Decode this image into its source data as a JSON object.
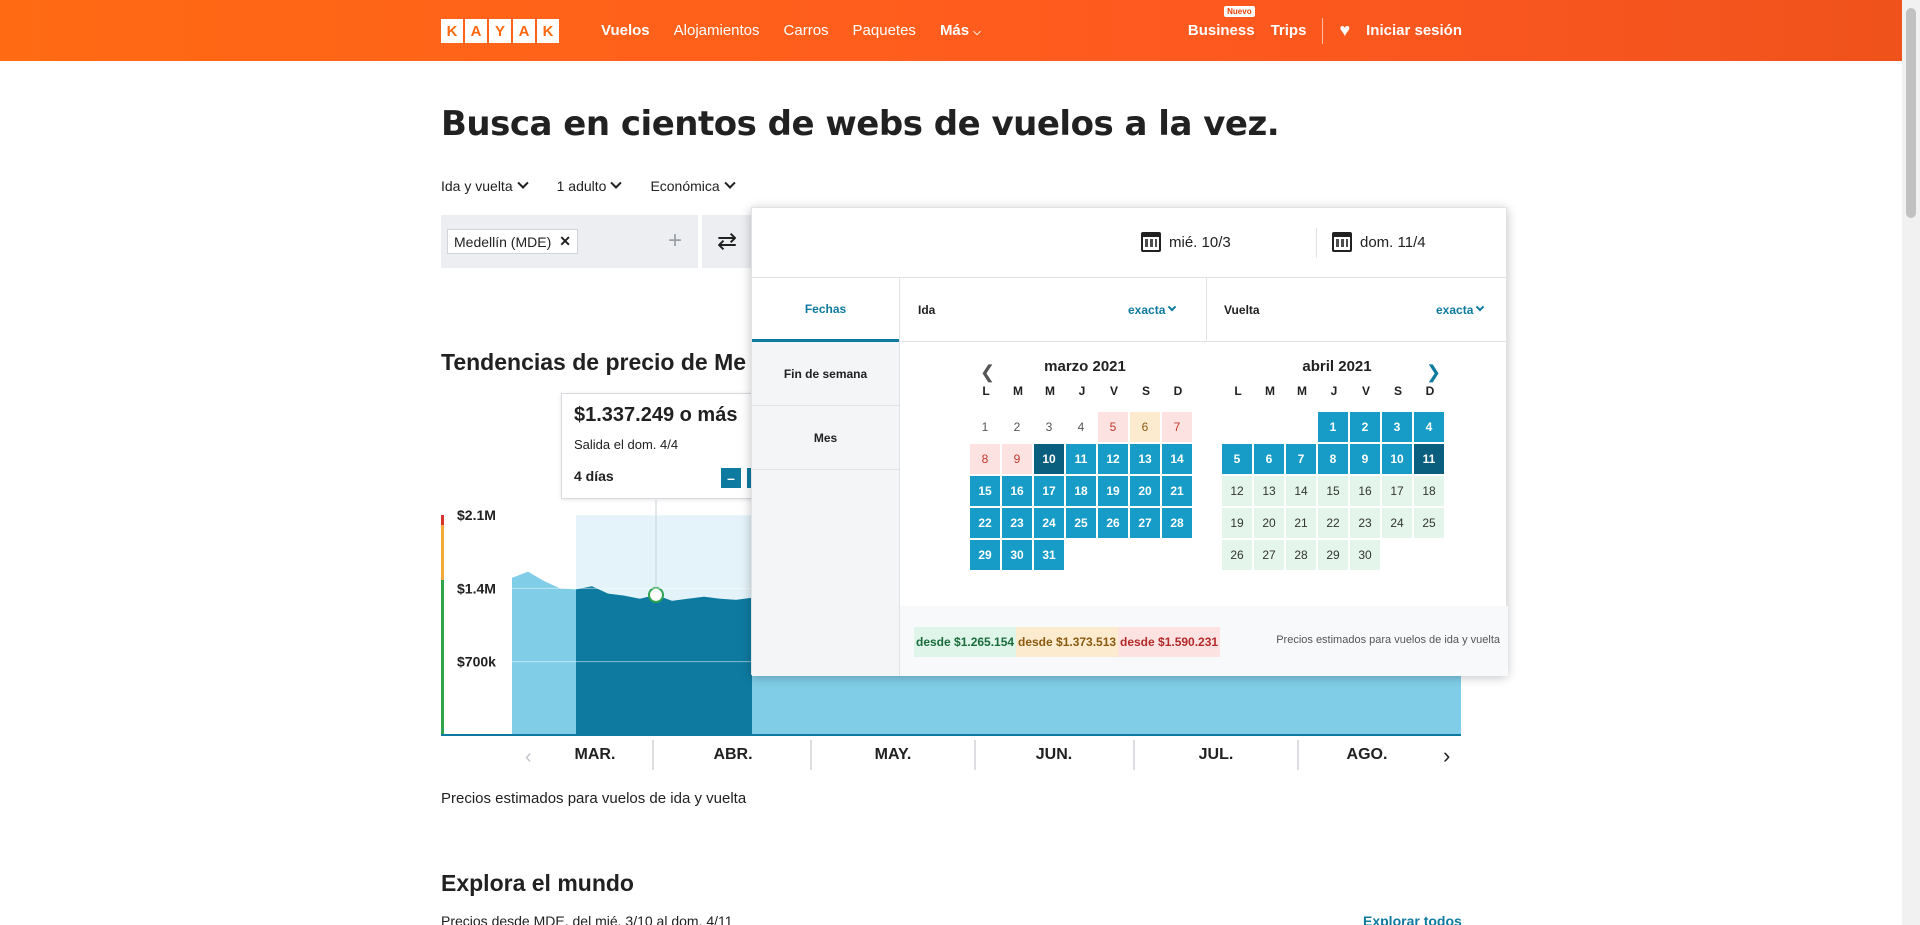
{
  "header": {
    "logo_letters": [
      "K",
      "A",
      "Y",
      "A",
      "K"
    ],
    "nav": [
      "Vuelos",
      "Alojamientos",
      "Carros",
      "Paquetes",
      "Más"
    ],
    "business": "Business",
    "business_badge": "Nuevo",
    "trips": "Trips",
    "login": "Iniciar sesión"
  },
  "main": {
    "title": "Busca en cientos de webs de vuelos a la vez.",
    "options": [
      "Ida y vuelta",
      "1 adulto",
      "Económica"
    ],
    "origin_chip": "Medellín (MDE)",
    "trend_title": "Tendencias de precio de Me",
    "note": "Precios estimados para vuelos de ida y vuelta",
    "explore_title": "Explora el mundo",
    "explore_sub": "Precios desde MDE, del mié. 3/10 al dom. 4/11",
    "explore_link": "Explorar todos"
  },
  "tooltip": {
    "price": "$1.337.249 o más",
    "departure": "Salida el dom. 4/4",
    "duration": "4 días",
    "minus": "–"
  },
  "chart_data": {
    "type": "area",
    "y_ticks": [
      "$2.1M",
      "$1.4M",
      "$700k"
    ],
    "x_months": [
      "MAR.",
      "ABR.",
      "MAY.",
      "JUN.",
      "JUL.",
      "AGO."
    ],
    "ylim": [
      0,
      2100000
    ],
    "values": [
      1500000,
      1560000,
      1470000,
      1400000,
      1390000,
      1420000,
      1350000,
      1330000,
      1300000,
      1337249,
      1280000,
      1300000,
      1320000,
      1300000,
      1290000,
      1310000
    ],
    "selected_range_start": 4,
    "selected_range_end": 15,
    "colors": {
      "area": "#7fcde6",
      "selected": "#0e7aa0",
      "highlight_bg": "#e3f3f9"
    }
  },
  "popup": {
    "depart_date": "mié. 10/3",
    "return_date": "dom. 11/4",
    "tabs": [
      "Fechas",
      "Fin de semana",
      "Mes"
    ],
    "leg_depart": "Ida",
    "leg_return": "Vuelta",
    "exact": "exacta",
    "march_title": "marzo 2021",
    "april_title": "abril 2021",
    "dow": [
      "L",
      "M",
      "M",
      "J",
      "V",
      "S",
      "D"
    ],
    "price_green": "desde $1.265.154",
    "price_orange": "desde $1.373.513",
    "price_red": "desde $1.590.231",
    "foot_note": "Precios estimados para vuelos de ida y vuelta"
  },
  "calendar": {
    "march": {
      "offset": 0,
      "days": [
        [
          "1",
          "plain"
        ],
        [
          "2",
          "plain"
        ],
        [
          "3",
          "plain"
        ],
        [
          "4",
          "plain"
        ],
        [
          "5",
          "red"
        ],
        [
          "6",
          "orange"
        ],
        [
          "7",
          "red"
        ],
        [
          "8",
          "red"
        ],
        [
          "9",
          "red"
        ],
        [
          "10",
          "end"
        ],
        [
          "11",
          "sel"
        ],
        [
          "12",
          "sel"
        ],
        [
          "13",
          "sel"
        ],
        [
          "14",
          "sel"
        ],
        [
          "15",
          "sel"
        ],
        [
          "16",
          "sel"
        ],
        [
          "17",
          "sel"
        ],
        [
          "18",
          "sel"
        ],
        [
          "19",
          "sel"
        ],
        [
          "20",
          "sel"
        ],
        [
          "21",
          "sel"
        ],
        [
          "22",
          "sel"
        ],
        [
          "23",
          "sel"
        ],
        [
          "24",
          "sel"
        ],
        [
          "25",
          "sel"
        ],
        [
          "26",
          "sel"
        ],
        [
          "27",
          "sel"
        ],
        [
          "28",
          "sel"
        ],
        [
          "29",
          "sel"
        ],
        [
          "30",
          "sel"
        ],
        [
          "31",
          "sel"
        ]
      ]
    },
    "april": {
      "offset": 3,
      "days": [
        [
          "1",
          "sel"
        ],
        [
          "2",
          "sel"
        ],
        [
          "3",
          "sel"
        ],
        [
          "4",
          "sel"
        ],
        [
          "5",
          "sel"
        ],
        [
          "6",
          "sel"
        ],
        [
          "7",
          "sel"
        ],
        [
          "8",
          "sel"
        ],
        [
          "9",
          "sel"
        ],
        [
          "10",
          "sel"
        ],
        [
          "11",
          "end"
        ],
        [
          "12",
          "green"
        ],
        [
          "13",
          "green"
        ],
        [
          "14",
          "green"
        ],
        [
          "15",
          "green"
        ],
        [
          "16",
          "green"
        ],
        [
          "17",
          "green"
        ],
        [
          "18",
          "green"
        ],
        [
          "19",
          "green"
        ],
        [
          "20",
          "green"
        ],
        [
          "21",
          "green"
        ],
        [
          "22",
          "green"
        ],
        [
          "23",
          "green"
        ],
        [
          "24",
          "green"
        ],
        [
          "25",
          "green"
        ],
        [
          "26",
          "green"
        ],
        [
          "27",
          "green"
        ],
        [
          "28",
          "green"
        ],
        [
          "29",
          "green"
        ],
        [
          "30",
          "green"
        ]
      ]
    }
  }
}
